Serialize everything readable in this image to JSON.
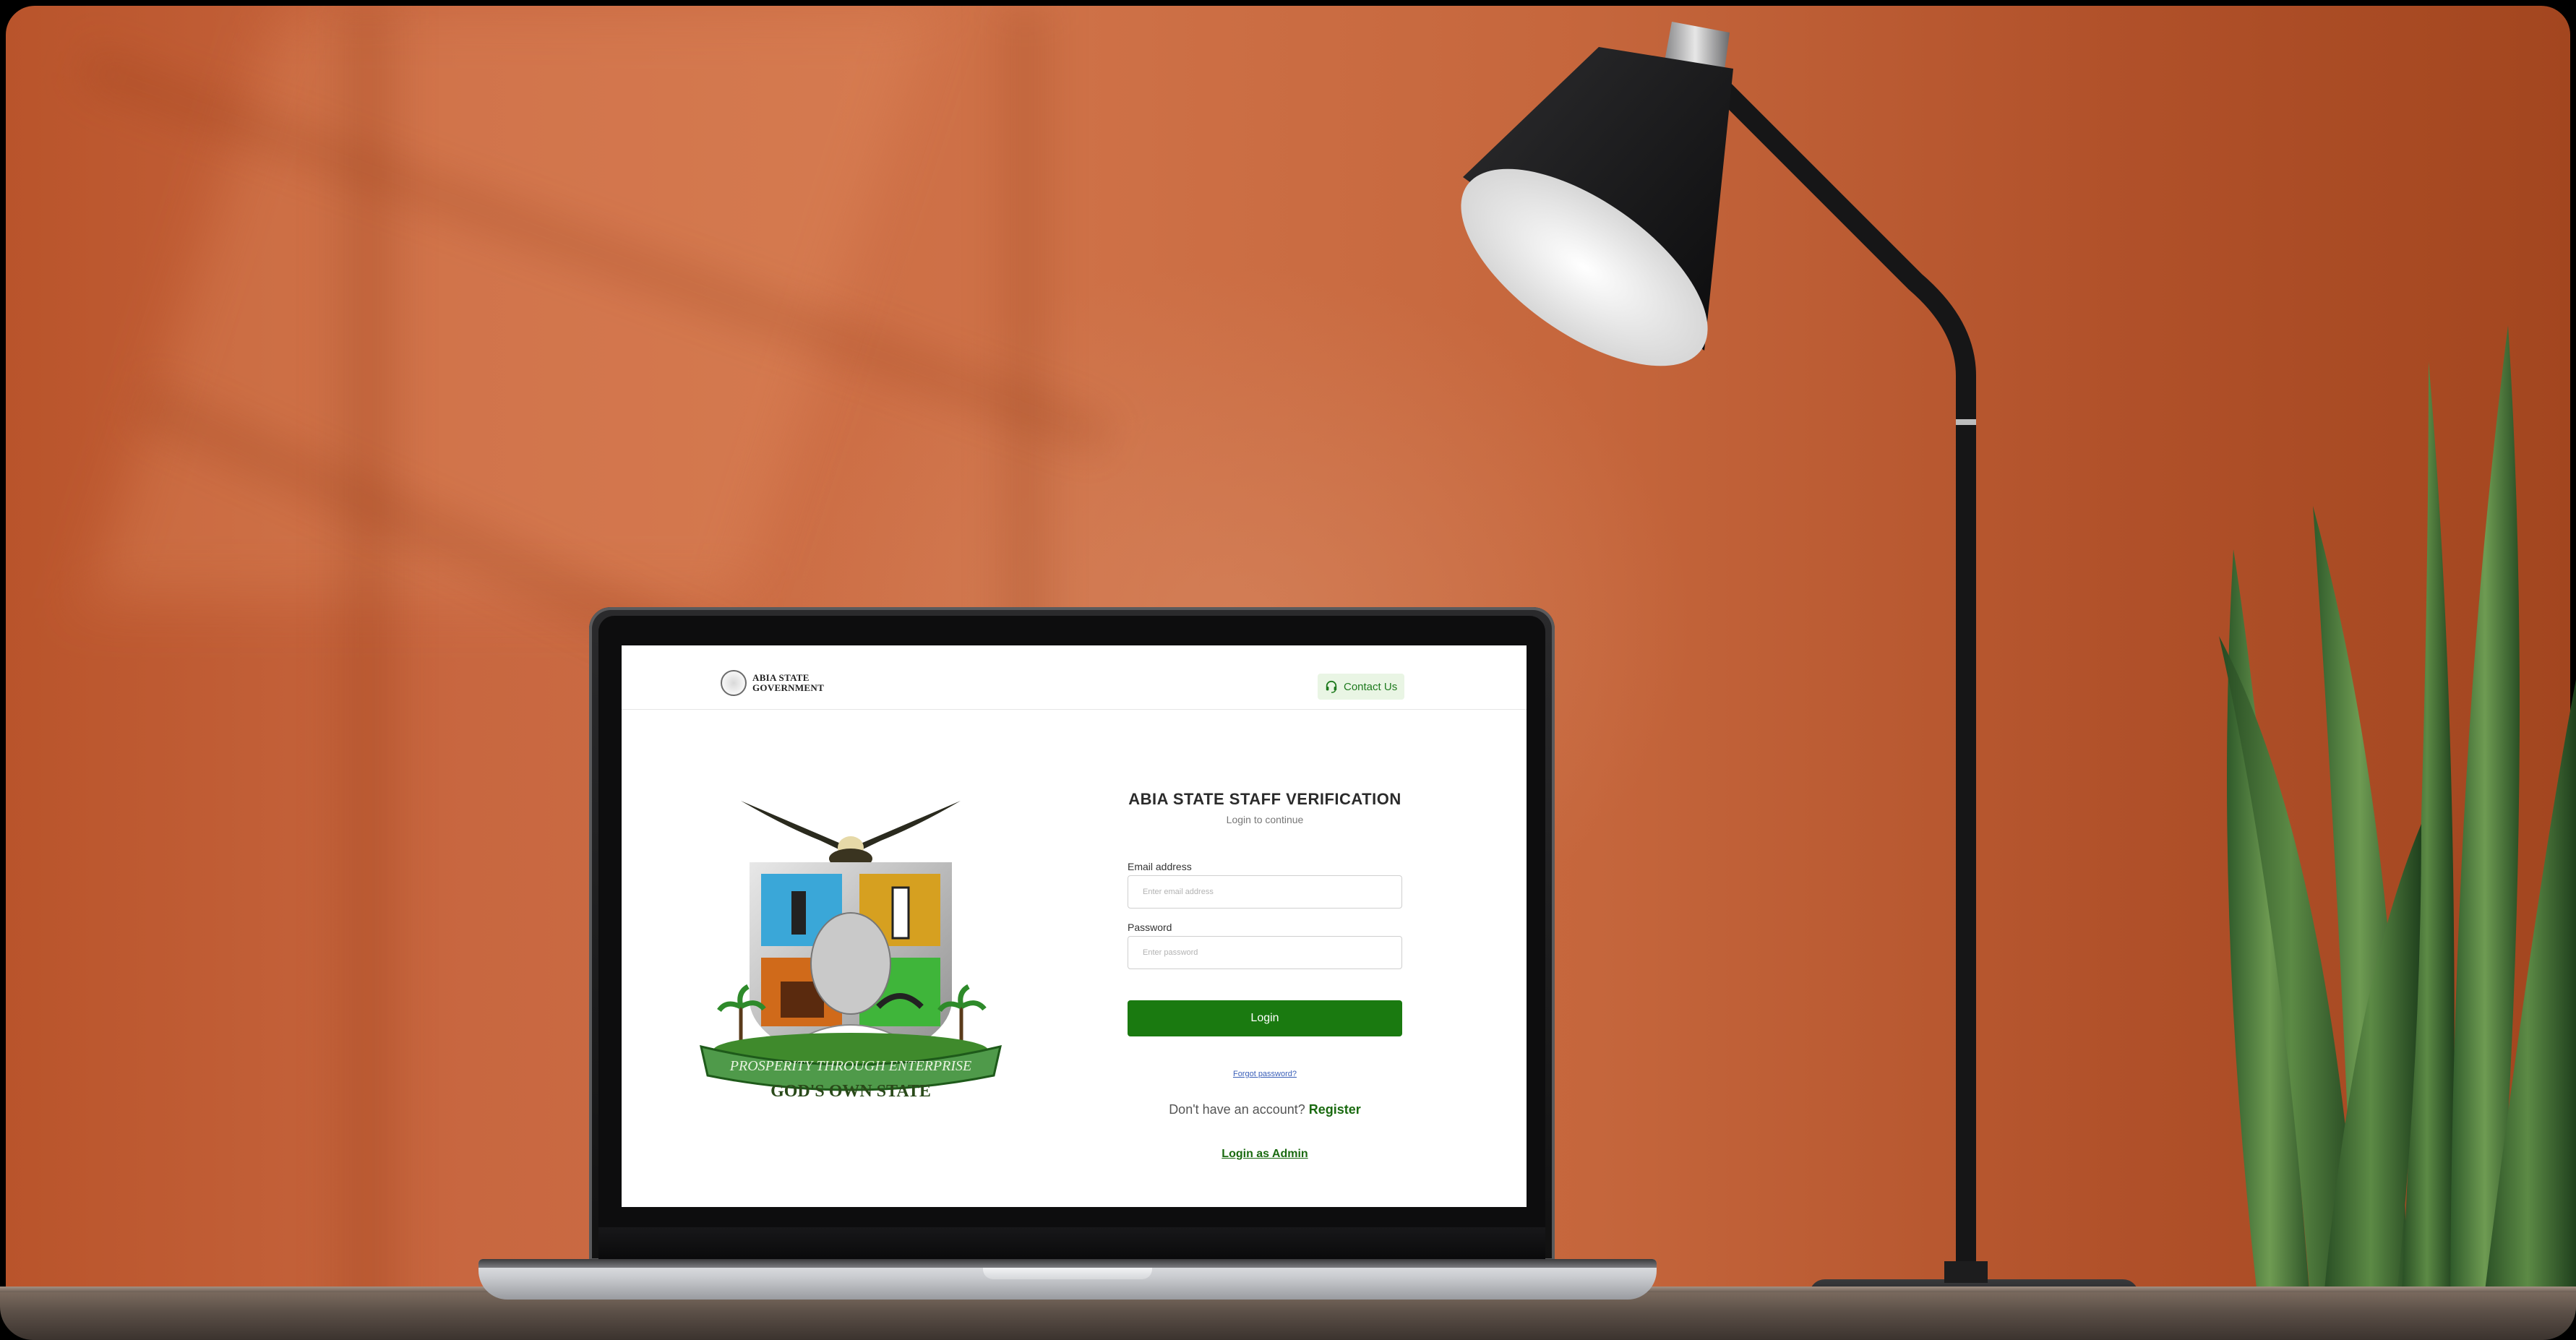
{
  "header": {
    "brand_line1": "ABIA STATE",
    "brand_line2": "GOVERNMENT",
    "contact_label": "Contact Us"
  },
  "crest": {
    "motto": "PROSPERITY THROUGH ENTERPRISE",
    "tagline": "GOD'S OWN STATE"
  },
  "login": {
    "title": "ABIA STATE STAFF VERIFICATION",
    "subtitle": "Login to continue",
    "email_label": "Email address",
    "email_placeholder": "Enter email address",
    "password_label": "Password",
    "password_placeholder": "Enter password",
    "submit_label": "Login",
    "forgot_label": "Forgot password?",
    "no_account_text": "Don't have an account?",
    "register_label": "Register",
    "admin_label": "Login as Admin"
  },
  "colors": {
    "brand_green": "#1a7a10",
    "contact_bg": "#e9f5e4",
    "link_blue": "#3a5fb8",
    "wall_orange": "#c86740"
  },
  "icons": {
    "contact": "headset-icon"
  }
}
